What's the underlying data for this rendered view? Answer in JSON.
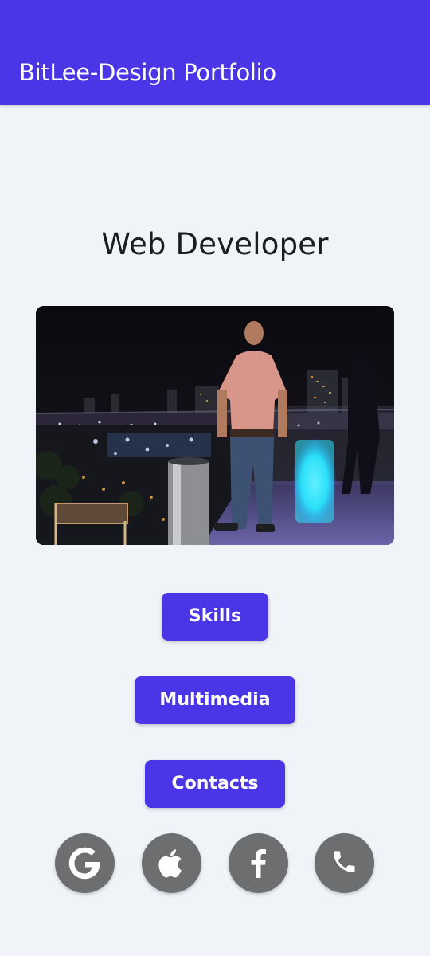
{
  "header": {
    "title": "BitLee-Design Portfolio",
    "background_color": "#4a36e6"
  },
  "main": {
    "headline": "Web Developer",
    "photo": {
      "icon": "profile-photo"
    },
    "buttons": [
      {
        "label": "Skills"
      },
      {
        "label": "Multimedia"
      },
      {
        "label": "Contacts"
      }
    ]
  },
  "social": [
    {
      "icon": "google-icon"
    },
    {
      "icon": "apple-icon"
    },
    {
      "icon": "facebook-icon"
    },
    {
      "icon": "phone-icon"
    }
  ],
  "colors": {
    "accent": "#4a36e6",
    "page_background": "#f0f3f8",
    "social_button": "#6c6e70"
  }
}
